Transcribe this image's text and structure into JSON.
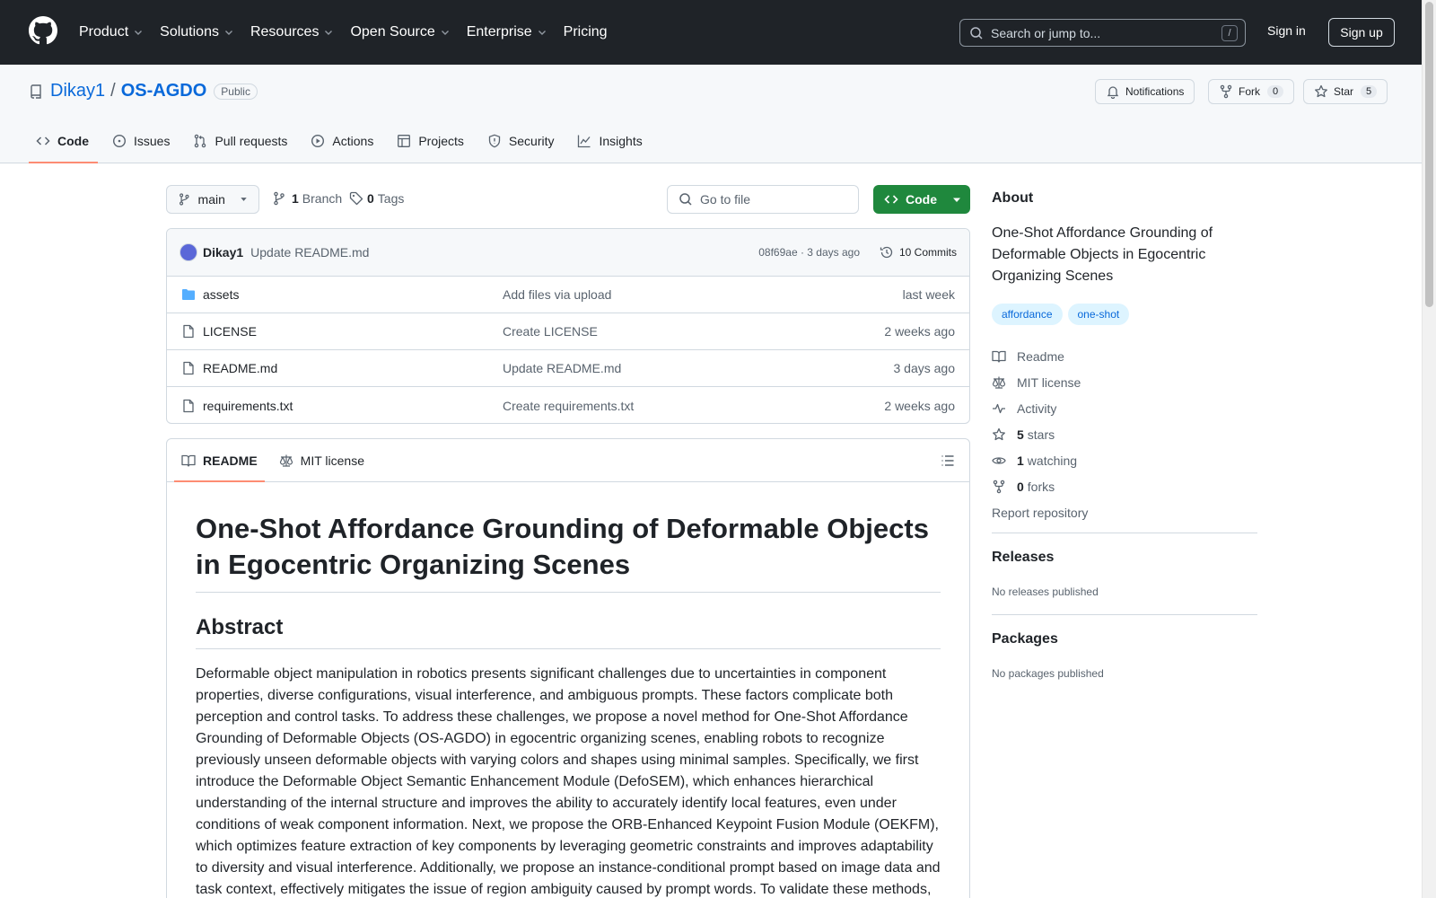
{
  "header": {
    "nav": [
      {
        "label": "Product",
        "dropdown": true
      },
      {
        "label": "Solutions",
        "dropdown": true
      },
      {
        "label": "Resources",
        "dropdown": true
      },
      {
        "label": "Open Source",
        "dropdown": true
      },
      {
        "label": "Enterprise",
        "dropdown": true
      },
      {
        "label": "Pricing",
        "dropdown": false
      }
    ],
    "search_placeholder": "Search or jump to...",
    "search_shortcut": "/",
    "signin": "Sign in",
    "signup": "Sign up"
  },
  "repo": {
    "owner": "Dikay1",
    "separator": "/",
    "name": "OS-AGDO",
    "visibility": "Public",
    "notifications_label": "Notifications",
    "fork_label": "Fork",
    "fork_count": "0",
    "star_label": "Star",
    "star_count": "5",
    "tabs": [
      {
        "label": "Code",
        "icon": "code-icon",
        "active": true
      },
      {
        "label": "Issues",
        "icon": "issue-icon",
        "active": false
      },
      {
        "label": "Pull requests",
        "icon": "pull-request-icon",
        "active": false
      },
      {
        "label": "Actions",
        "icon": "play-icon",
        "active": false
      },
      {
        "label": "Projects",
        "icon": "table-icon",
        "active": false
      },
      {
        "label": "Security",
        "icon": "shield-icon",
        "active": false
      },
      {
        "label": "Insights",
        "icon": "graph-icon",
        "active": false
      }
    ]
  },
  "toolbar": {
    "branch": "main",
    "branch_count": "1",
    "branch_label": "Branch",
    "tag_count": "0",
    "tag_label": "Tags",
    "goto_placeholder": "Go to file",
    "code_button": "Code"
  },
  "commit": {
    "author": "Dikay1",
    "message": "Update README.md",
    "meta": "08f69ae · 3 days ago",
    "commits": "10 Commits"
  },
  "files": [
    {
      "name": "assets",
      "type": "folder",
      "message": "Add files via upload",
      "date": "last week"
    },
    {
      "name": "LICENSE",
      "type": "file",
      "message": "Create LICENSE",
      "date": "2 weeks ago"
    },
    {
      "name": "README.md",
      "type": "file",
      "message": "Update README.md",
      "date": "3 days ago"
    },
    {
      "name": "requirements.txt",
      "type": "file",
      "message": "Create requirements.txt",
      "date": "2 weeks ago"
    }
  ],
  "readme": {
    "tab_readme": "README",
    "tab_license": "MIT license",
    "title": "One-Shot Affordance Grounding of Deformable Objects in Egocentric Organizing Scenes",
    "abstract_heading": "Abstract",
    "abstract": "Deformable object manipulation in robotics presents significant challenges due to uncertainties in component properties, diverse configurations, visual interference, and ambiguous prompts. These factors complicate both perception and control tasks. To address these challenges, we propose a novel method for One-Shot Affordance Grounding of Deformable Objects (OS-AGDO) in egocentric organizing scenes, enabling robots to recognize previously unseen deformable objects with varying colors and shapes using minimal samples. Specifically, we first introduce the Deformable Object Semantic Enhancement Module (DefoSEM), which enhances hierarchical understanding of the internal structure and improves the ability to accurately identify local features, even under conditions of weak component information. Next, we propose the ORB-Enhanced Keypoint Fusion Module (OEKFM), which optimizes feature extraction of key components by leveraging geometric constraints and improves adaptability to diversity and visual interference. Additionally, we propose an instance-conditional prompt based on image data and task context, effectively mitigates the issue of region ambiguity caused by prompt words. To validate these methods,"
  },
  "sidebar": {
    "about_heading": "About",
    "description": "One-Shot Affordance Grounding of Deformable Objects in Egocentric Organizing Scenes",
    "topics": [
      "affordance",
      "one-shot"
    ],
    "readme": "Readme",
    "license": "MIT license",
    "activity": "Activity",
    "stars_count": "5",
    "stars_label": "stars",
    "watching_count": "1",
    "watching_label": "watching",
    "forks_count": "0",
    "forks_label": "forks",
    "report": "Report repository",
    "releases_heading": "Releases",
    "releases_text": "No releases published",
    "packages_heading": "Packages",
    "packages_text": "No packages published"
  },
  "colors": {
    "header_bg": "#1f2328",
    "link": "#0969da",
    "primary_button": "#1f883d",
    "active_tab_underline": "#fd8c73",
    "topic_bg": "#ddf4ff"
  }
}
